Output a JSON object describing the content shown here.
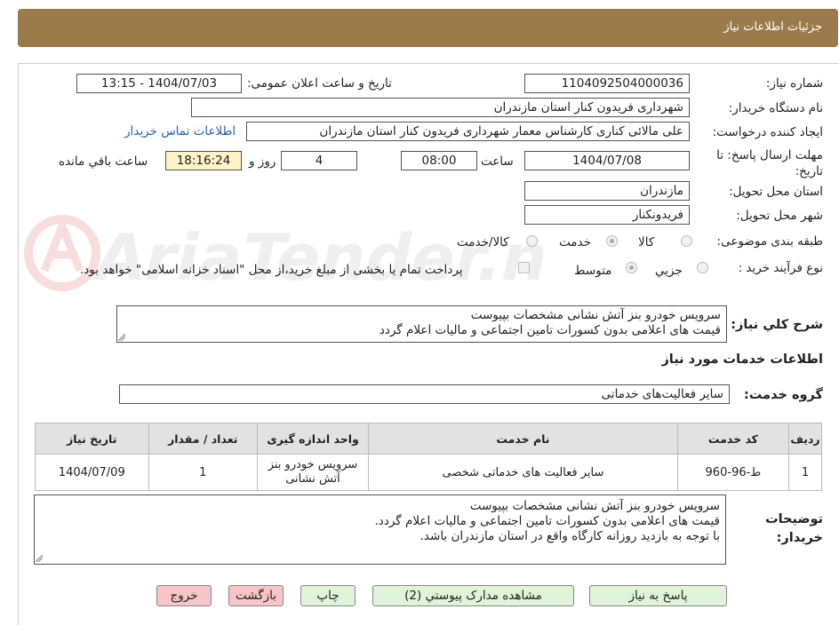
{
  "header": {
    "title": "جزئیات اطلاعات نیاز"
  },
  "form": {
    "need_number_label": "شماره نیاز:",
    "need_number": "1104092504000036",
    "announce_label": "تاریخ و ساعت اعلان عمومی:",
    "announce_value": "1404/07/03 - 13:15",
    "buyer_org_label": "نام دستگاه خریدار:",
    "buyer_org": "شهرداری فریدون کنار استان مازندران",
    "requester_label": "ایجاد کننده درخواست:",
    "requester": "علی مالائی کناری کارشناس معمار شهرداری فریدون کنار استان مازندران",
    "contact_link": "اطلاعات تماس خریدار",
    "deadline_label": "مهلت ارسال پاسخ: تا تاریخ:",
    "deadline_date": "1404/07/08",
    "time_label": "ساعت",
    "deadline_time": "08:00",
    "days_value": "4",
    "days_label": "روز و",
    "remaining_time": "18:16:24",
    "remaining_label": "ساعت باقي مانده",
    "province_label": "استان محل تحویل:",
    "province": "مازندران",
    "city_label": "شهر محل تحویل:",
    "city": "فریدونکنار",
    "category_label": "طبقه بندی موضوعی:",
    "category_options": [
      "کالا",
      "خدمت",
      "کالا/خدمت"
    ],
    "category_selected": "خدمت",
    "process_label": "نوع فرآیند خرید :",
    "process_options": [
      "جزيي",
      "متوسط"
    ],
    "process_selected": "متوسط",
    "payment_note": "پرداخت تمام یا بخشی از مبلغ خرید،از محل \"اسناد خزانه اسلامی\" خواهد بود.",
    "description_label": "شرح کلي نياز:",
    "description_lines": [
      "سرویس خودرو بنز آتش نشانی مشخصات بپیوست",
      "قیمت های اعلامی بدون کسورات تامین اجتماعی و مالیات اعلام گردد"
    ]
  },
  "services": {
    "section_title": "اطلاعات خدمات مورد نیاز",
    "group_label": "گروه خدمت:",
    "group_value": "سایر فعالیت‌های خدماتی",
    "columns": [
      "ردیف",
      "کد خدمت",
      "نام خدمت",
      "واحد اندازه گیری",
      "تعداد / مقدار",
      "تاریخ نیاز"
    ],
    "rows": [
      {
        "row": "1",
        "code": "ط-96-960",
        "name": "سایر فعالیت های خدماتی شخصی",
        "unit": "سرویس خودرو بنز آتش نشانی",
        "qty": "1",
        "date": "1404/07/09"
      }
    ]
  },
  "buyer_notes": {
    "label": "توضیحات خریدار:",
    "lines": [
      "سرویس خودرو بنز آتش نشانی مشخصات بپیوست",
      "قیمت های اعلامی بدون کسورات تامین اجتماعی و مالیات اعلام گردد.",
      "با توجه به بازدید روزانه کارگاه واقع در استان مازندران باشد."
    ]
  },
  "buttons": {
    "reply": "پاسخ به نیاز",
    "attachments": "مشاهده مدارک پیوستي (2)",
    "print": "چاپ",
    "back": "بازگشت",
    "exit": "خروج"
  },
  "colors": {
    "header_bg": "#9b7b4b",
    "time_bg": "#fdf3c6",
    "btn_green": "#dff3d9",
    "btn_pink": "#f7c5c8",
    "link": "#1f5fb3"
  },
  "watermark": {
    "text": "AriaTender.neT"
  }
}
